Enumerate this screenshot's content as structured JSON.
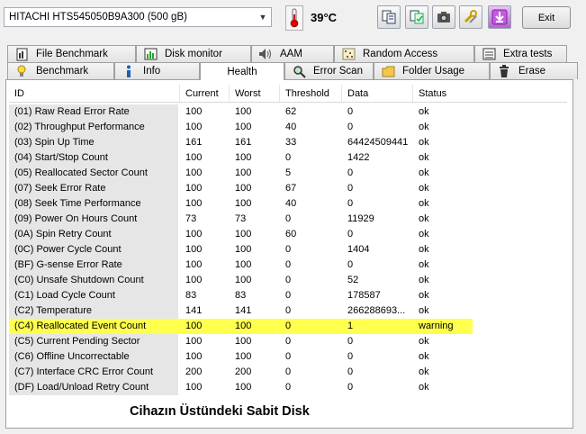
{
  "toolbar": {
    "drive": "HITACHI HTS545050B9A300 (500 gB)",
    "temperature": "39°C",
    "exit_label": "Exit",
    "icons": [
      "copy-icon",
      "save-icon",
      "camera-icon",
      "tools-icon",
      "download-icon"
    ]
  },
  "tabs": {
    "top_row": [
      {
        "label": "File Benchmark",
        "icon": "file-benchmark-icon"
      },
      {
        "label": "Disk monitor",
        "icon": "disk-monitor-icon"
      },
      {
        "label": "AAM",
        "icon": "speaker-icon"
      },
      {
        "label": "Random Access",
        "icon": "random-access-icon"
      },
      {
        "label": "Extra tests",
        "icon": "extra-tests-icon"
      }
    ],
    "bottom_row": [
      {
        "label": "Benchmark",
        "icon": "benchmark-icon"
      },
      {
        "label": "Info",
        "icon": "info-icon"
      },
      {
        "label": "Health",
        "icon": ""
      },
      {
        "label": "Error Scan",
        "icon": "error-scan-icon"
      },
      {
        "label": "Folder Usage",
        "icon": "folder-icon"
      },
      {
        "label": "Erase",
        "icon": "trash-icon"
      }
    ],
    "active": "Health"
  },
  "table": {
    "columns": [
      "ID",
      "Current",
      "Worst",
      "Threshold",
      "Data",
      "Status"
    ],
    "rows": [
      {
        "id": "(01) Raw Read Error Rate",
        "current": "100",
        "worst": "100",
        "threshold": "62",
        "data": "0",
        "status": "ok"
      },
      {
        "id": "(02) Throughput Performance",
        "current": "100",
        "worst": "100",
        "threshold": "40",
        "data": "0",
        "status": "ok"
      },
      {
        "id": "(03) Spin Up Time",
        "current": "161",
        "worst": "161",
        "threshold": "33",
        "data": "64424509441",
        "status": "ok"
      },
      {
        "id": "(04) Start/Stop Count",
        "current": "100",
        "worst": "100",
        "threshold": "0",
        "data": "1422",
        "status": "ok"
      },
      {
        "id": "(05) Reallocated Sector Count",
        "current": "100",
        "worst": "100",
        "threshold": "5",
        "data": "0",
        "status": "ok"
      },
      {
        "id": "(07) Seek Error Rate",
        "current": "100",
        "worst": "100",
        "threshold": "67",
        "data": "0",
        "status": "ok"
      },
      {
        "id": "(08) Seek Time Performance",
        "current": "100",
        "worst": "100",
        "threshold": "40",
        "data": "0",
        "status": "ok"
      },
      {
        "id": "(09) Power On Hours Count",
        "current": "73",
        "worst": "73",
        "threshold": "0",
        "data": "11929",
        "status": "ok"
      },
      {
        "id": "(0A) Spin Retry Count",
        "current": "100",
        "worst": "100",
        "threshold": "60",
        "data": "0",
        "status": "ok"
      },
      {
        "id": "(0C) Power Cycle Count",
        "current": "100",
        "worst": "100",
        "threshold": "0",
        "data": "1404",
        "status": "ok"
      },
      {
        "id": "(BF) G-sense Error Rate",
        "current": "100",
        "worst": "100",
        "threshold": "0",
        "data": "0",
        "status": "ok"
      },
      {
        "id": "(C0) Unsafe Shutdown Count",
        "current": "100",
        "worst": "100",
        "threshold": "0",
        "data": "52",
        "status": "ok"
      },
      {
        "id": "(C1) Load Cycle Count",
        "current": "83",
        "worst": "83",
        "threshold": "0",
        "data": "178587",
        "status": "ok"
      },
      {
        "id": "(C2) Temperature",
        "current": "141",
        "worst": "141",
        "threshold": "0",
        "data": "266288693...",
        "status": "ok"
      },
      {
        "id": "(C4) Reallocated Event Count",
        "current": "100",
        "worst": "100",
        "threshold": "0",
        "data": "1",
        "status": "warning"
      },
      {
        "id": "(C5) Current Pending Sector",
        "current": "100",
        "worst": "100",
        "threshold": "0",
        "data": "0",
        "status": "ok"
      },
      {
        "id": "(C6) Offline Uncorrectable",
        "current": "100",
        "worst": "100",
        "threshold": "0",
        "data": "0",
        "status": "ok"
      },
      {
        "id": "(C7) Interface CRC Error Count",
        "current": "200",
        "worst": "200",
        "threshold": "0",
        "data": "0",
        "status": "ok"
      },
      {
        "id": "(DF) Load/Unload Retry Count",
        "current": "100",
        "worst": "100",
        "threshold": "0",
        "data": "0",
        "status": "ok"
      }
    ]
  },
  "caption": "Cihazın Üstündeki Sabit Disk",
  "colors": {
    "warning_highlight": "#ffff4d",
    "id_column_bg": "#e6e6e6"
  }
}
